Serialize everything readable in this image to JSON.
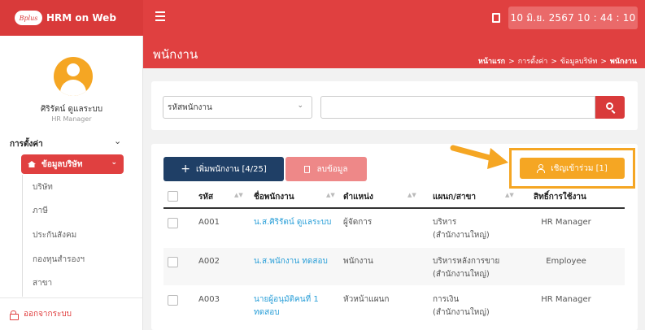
{
  "app": {
    "logo_text": "Bplus",
    "name": "HRM on Web",
    "clock": "10 มิ.ย. 2567  10 : 44 : 10"
  },
  "user": {
    "name": "ศิริรัตน์ ดูแลระบบ",
    "role": "HR Manager"
  },
  "sidebar": {
    "section_title": "การตั้งค่า",
    "active_item": "ข้อมูลบริษัท",
    "items": [
      {
        "label": "บริษัท"
      },
      {
        "label": "ภาษี"
      },
      {
        "label": "ประกันสังคม"
      },
      {
        "label": "กองทุนสำรองฯ"
      },
      {
        "label": "สาขา"
      }
    ],
    "logout_label": "ออกจากระบบ"
  },
  "page": {
    "title": "พนักงาน",
    "breadcrumb": [
      "หน้าแรก",
      "การตั้งค่า",
      "ข้อมูลบริษัท",
      "พนักงาน"
    ],
    "breadcrumb_sep": ">"
  },
  "search": {
    "field_select": "รหัสพนักงาน",
    "query": ""
  },
  "toolbar": {
    "add_label": "เพิ่มพนักงาน [4/25]",
    "delete_label": "ลบข้อมูล",
    "invite_label": "เชิญเข้าร่วม [1]"
  },
  "table": {
    "columns": [
      "รหัส",
      "ชื่อพนักงาน",
      "ตำแหน่ง",
      "แผนก/สาขา",
      "สิทธิ์การใช้งาน"
    ],
    "rows": [
      {
        "code": "A001",
        "name": "น.ส.ศิริรัตน์ ดูแลระบบ",
        "name_line2": "",
        "position": "ผู้จัดการ",
        "dept": "บริหาร",
        "dept_line2": "(สำนักงานใหญ่)",
        "permission": "HR Manager"
      },
      {
        "code": "A002",
        "name": "น.ส.พนักงาน ทดสอบ",
        "name_line2": "",
        "position": "พนักงาน",
        "dept": "บริหารหลังการขาย",
        "dept_line2": "(สำนักงานใหญ่)",
        "permission": "Employee"
      },
      {
        "code": "A003",
        "name": "นายผู้อนุมัติคนที่ 1",
        "name_line2": "ทดสอบ",
        "position": "หัวหน้าแผนก",
        "dept": "การเงิน",
        "dept_line2": "(สำนักงานใหญ่)",
        "permission": "HR Manager"
      }
    ]
  },
  "colors": {
    "primary": "#e04040",
    "navy": "#1f3f66",
    "accent": "#f5a623",
    "link": "#2a9fd8"
  },
  "icons": {
    "menu": "hamburger-icon",
    "save": "save-icon",
    "home": "home-icon",
    "search": "search-icon",
    "add": "plus-icon",
    "delete": "trash-icon",
    "invite": "user-icon",
    "logout": "lock-icon"
  }
}
